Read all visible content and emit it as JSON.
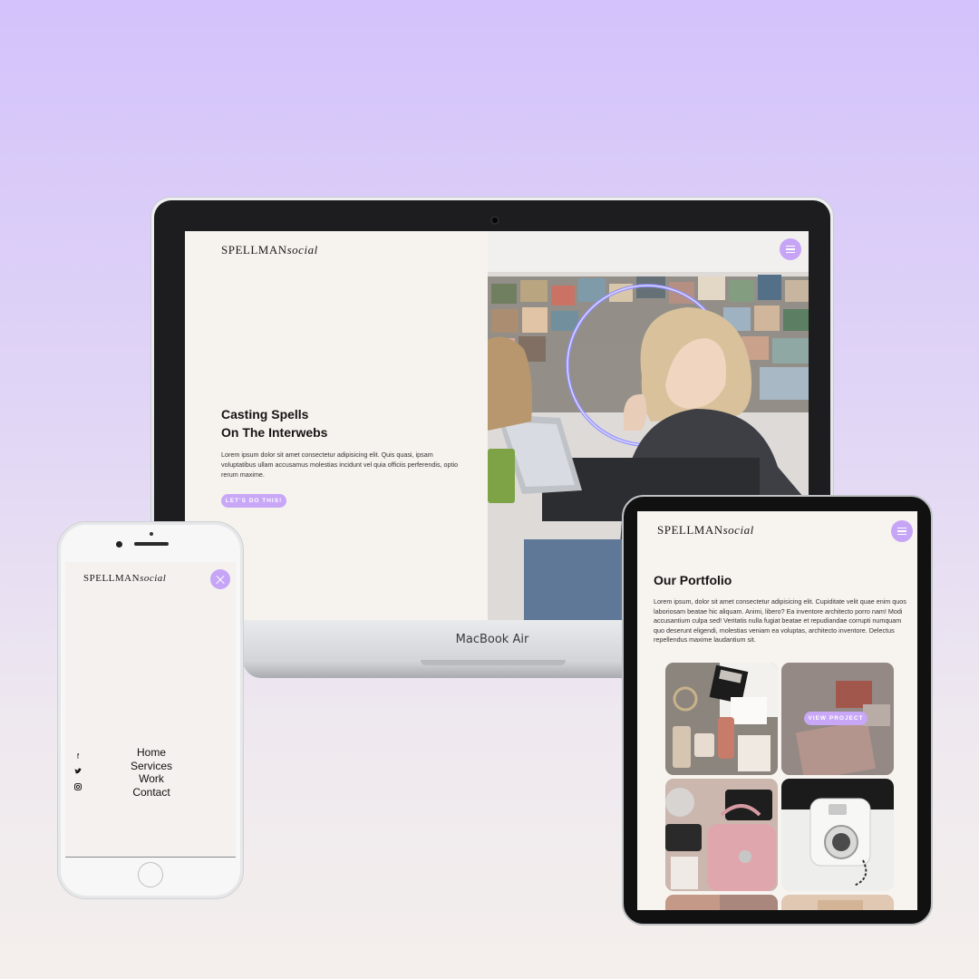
{
  "laptop": {
    "model_label": "MacBook Air",
    "logo": {
      "bold": "SPELLMAN",
      "italic": "social"
    },
    "hero": {
      "title_line1": "Casting Spells",
      "title_line2": "On The Interwebs",
      "body": "Lorem ipsum dolor sit amet consectetur adipisicing elit. Quis quasi, ipsam voluptatibus ullam accusamus molestias incidunt vel quia officiis perferendis, optio rerum maxime.",
      "cta": "LET'S DO THIS!"
    }
  },
  "phone": {
    "logo": {
      "bold": "SPELLMAN",
      "italic": "social"
    },
    "nav": [
      "Home",
      "Services",
      "Work",
      "Contact"
    ],
    "social_icons": [
      "facebook-icon",
      "twitter-icon",
      "instagram-icon"
    ]
  },
  "tablet": {
    "logo": {
      "bold": "SPELLMAN",
      "italic": "social"
    },
    "portfolio_title": "Our Portfolio",
    "portfolio_body": "Lorem ipsum, dolor sit amet consectetur adipisicing elit. Cupiditate velit quae enim quos laboriosam beatae hic aliquam. Animi, libero? Ea inventore architecto porro nam! Modi accusantium culpa sed! Veritatis nulla fugiat beatae et repudiandae corrupti numquam quo deserunt eligendi, molestias veniam ea voluptas, architecto inventore. Delectus repellendus maxime laudantium sit.",
    "view_project": "VIEW PROJECT",
    "tiles": [
      "flatlay-accessories",
      "flatlay-notebook",
      "pink-handbag",
      "instant-camera",
      "partial-tile",
      "partial-tile"
    ]
  },
  "colors": {
    "accent": "#c6a5f6",
    "bg_top": "#d3c2fb",
    "bg_bottom": "#f4efec",
    "screen_bg": "#f6f2ee"
  }
}
